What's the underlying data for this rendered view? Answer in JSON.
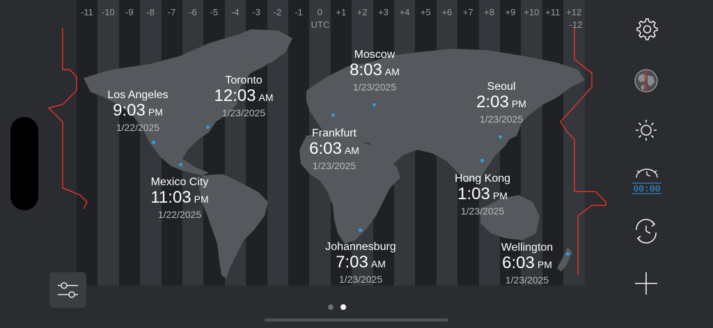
{
  "timezone_bar": {
    "offsets": [
      "-11",
      "-10",
      "-9",
      "-8",
      "-7",
      "-6",
      "-5",
      "-4",
      "-3",
      "-2",
      "-1",
      "0",
      "+1",
      "+2",
      "+3",
      "+4",
      "+5",
      "+6",
      "+7",
      "+8",
      "+9",
      "+10",
      "+11",
      "+12"
    ],
    "utc_label": "UTC",
    "extra_label": "-12"
  },
  "cities": [
    {
      "name": "Los Angeles",
      "time": "9:03",
      "ampm": "PM",
      "date": "1/22/2025"
    },
    {
      "name": "Toronto",
      "time": "12:03",
      "ampm": "AM",
      "date": "1/23/2025"
    },
    {
      "name": "Moscow",
      "time": "8:03",
      "ampm": "AM",
      "date": "1/23/2025"
    },
    {
      "name": "Seoul",
      "time": "2:03",
      "ampm": "PM",
      "date": "1/23/2025"
    },
    {
      "name": "Frankfurt",
      "time": "6:03",
      "ampm": "AM",
      "date": "1/23/2025"
    },
    {
      "name": "Mexico City",
      "time": "11:03",
      "ampm": "PM",
      "date": "1/22/2025"
    },
    {
      "name": "Hong Kong",
      "time": "1:03",
      "ampm": "PM",
      "date": "1/23/2025"
    },
    {
      "name": "Johannesburg",
      "time": "7:03",
      "ampm": "AM",
      "date": "1/23/2025"
    },
    {
      "name": "Wellington",
      "time": "6:03",
      "ampm": "PM",
      "date": "1/23/2025"
    }
  ],
  "toolbar": {
    "icons": [
      "gear-icon",
      "globe-icon",
      "brightness-icon",
      "alarm-clock-icon",
      "rotate-clock-icon",
      "plus-icon"
    ],
    "digital_clock_text": "00:00"
  },
  "colors": {
    "accent": "#2f9fe6",
    "dateline": "#e0352b",
    "land": "#55585c"
  },
  "pagination": {
    "pages": 2,
    "current": 2
  }
}
